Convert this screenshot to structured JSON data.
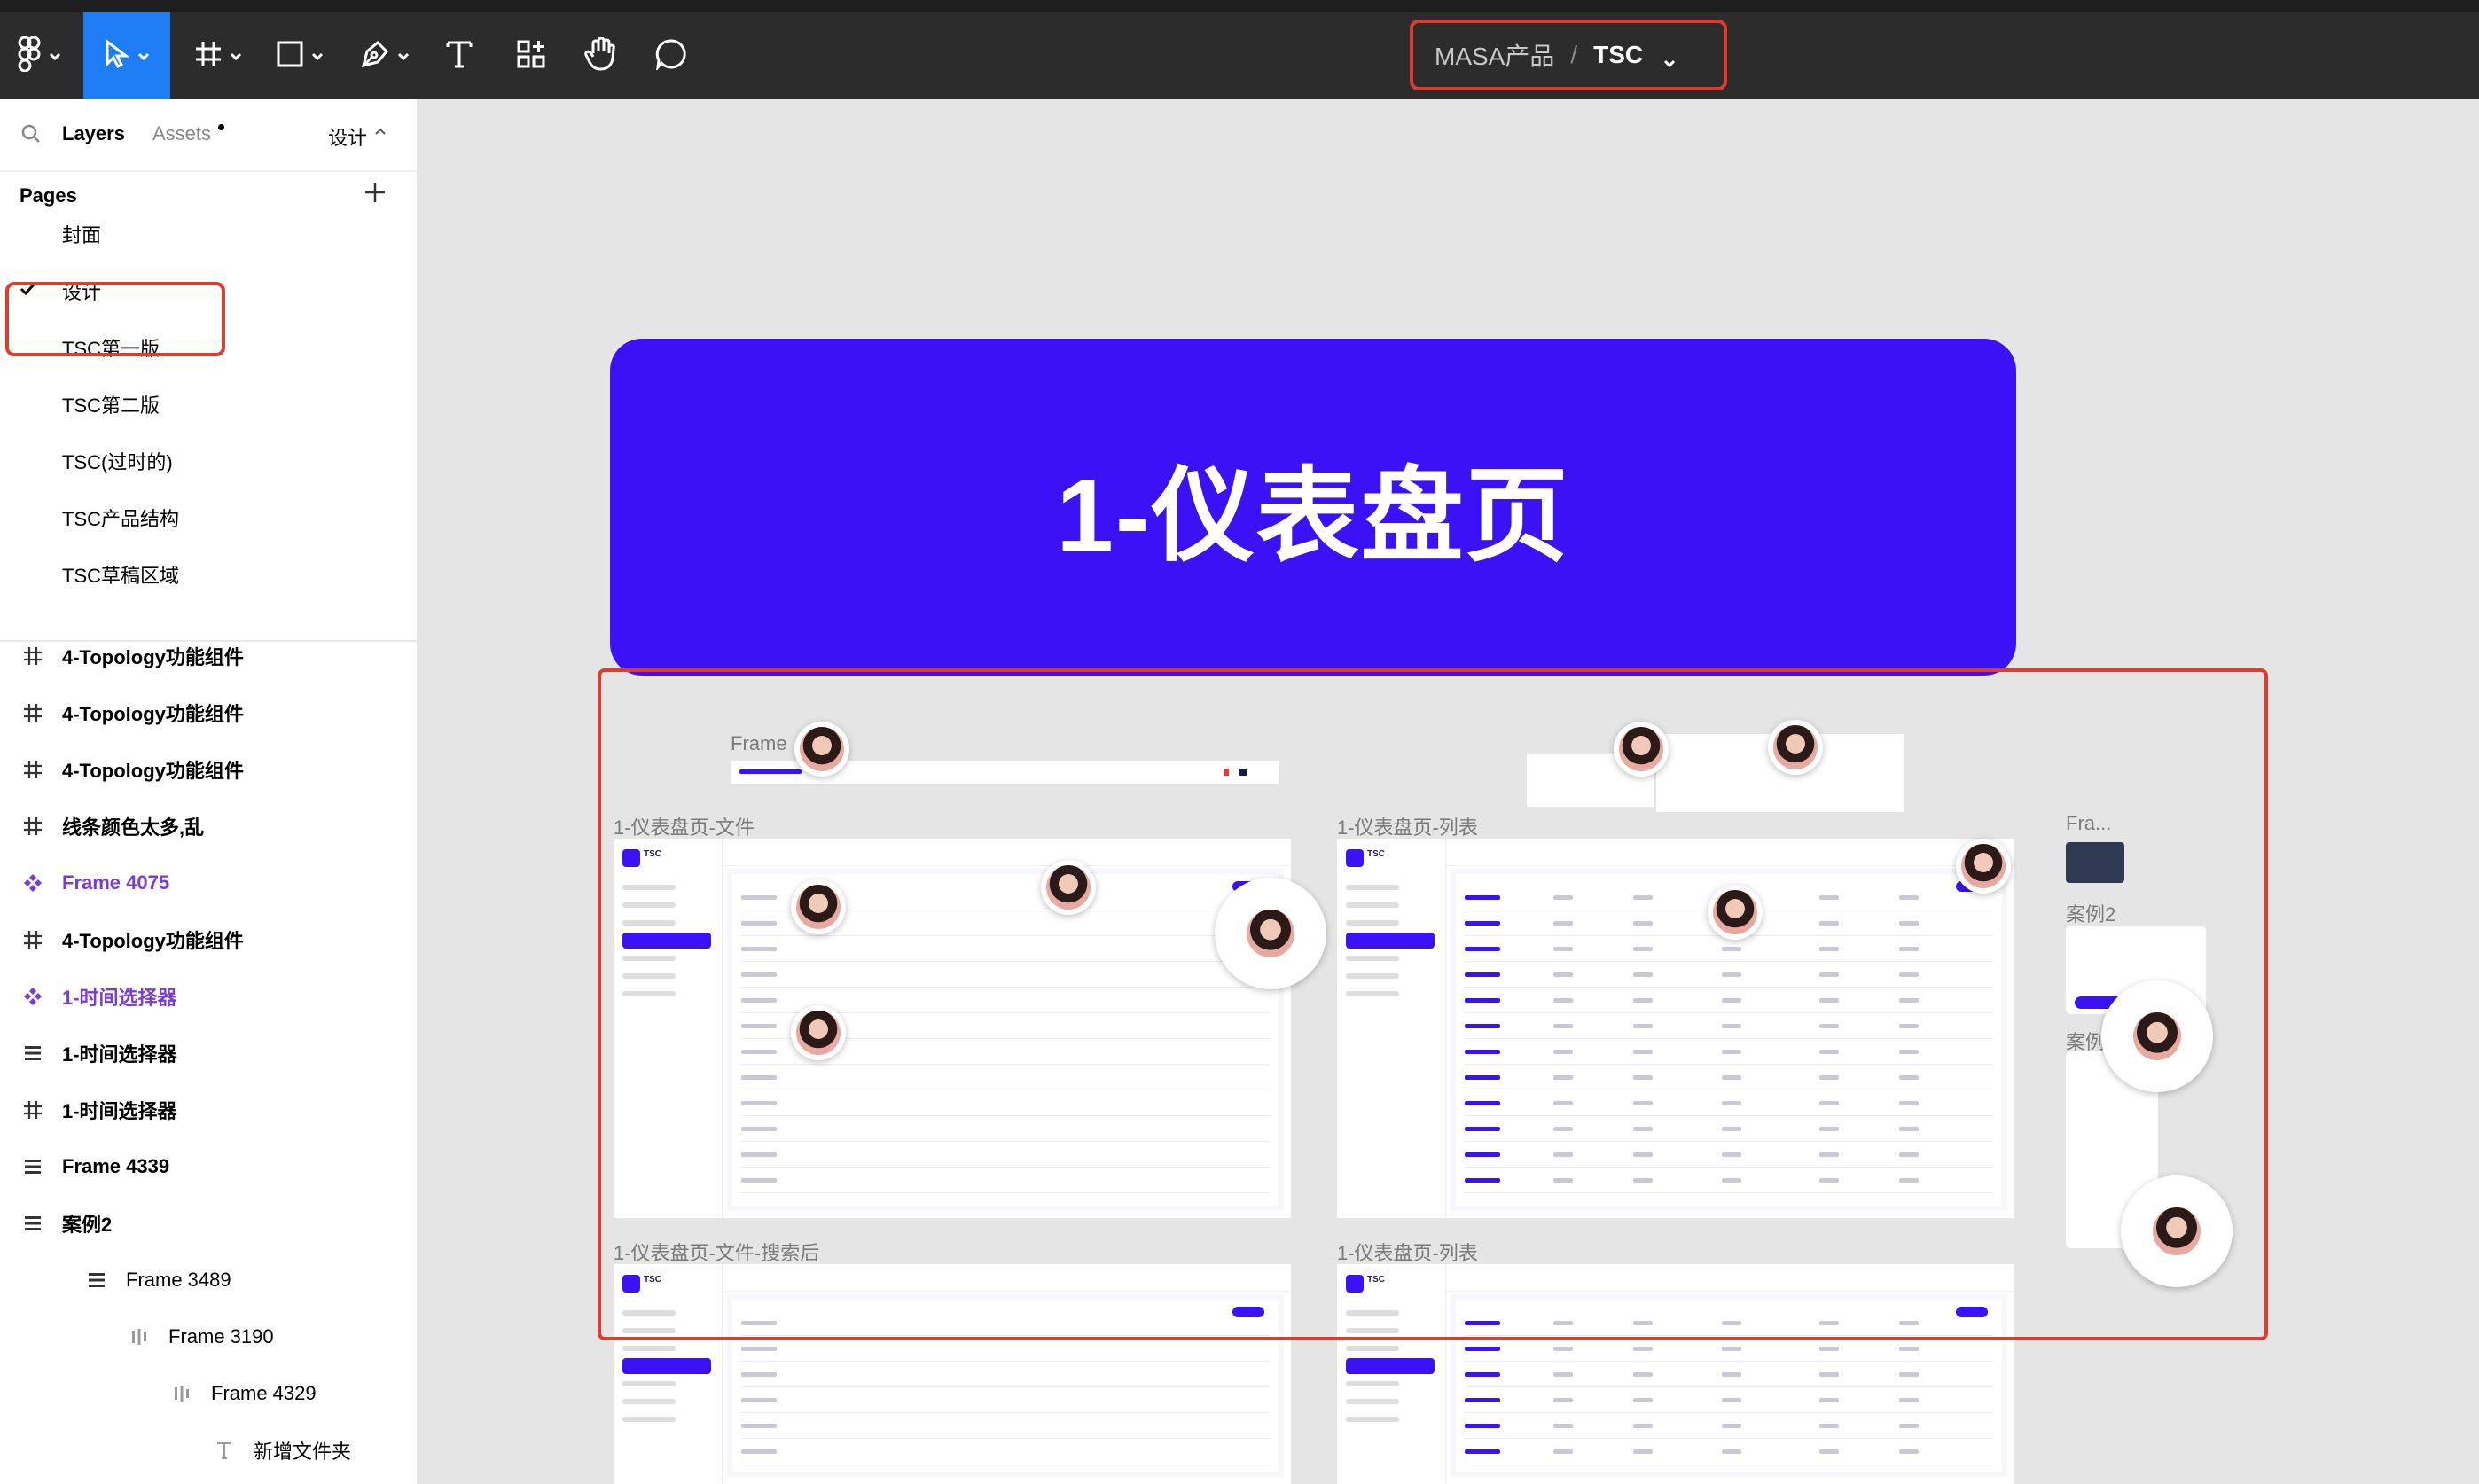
{
  "toolbar": {
    "project": "MASA产品",
    "separator": "/",
    "file": "TSC"
  },
  "panel": {
    "tabs": {
      "layers": "Layers",
      "assets": "Assets",
      "page_switch": "设计"
    },
    "pages_header": "Pages",
    "pages": [
      {
        "label": "封面",
        "selected": false
      },
      {
        "label": "设计",
        "selected": true
      },
      {
        "label": "TSC第一版",
        "selected": false
      },
      {
        "label": "TSC第二版",
        "selected": false
      },
      {
        "label": "TSC(过时的)",
        "selected": false
      },
      {
        "label": "TSC产品结构",
        "selected": false
      },
      {
        "label": "TSC草稿区域",
        "selected": false
      }
    ],
    "layers": [
      {
        "label": "4-Topology功能组件",
        "icon": "frame-icon"
      },
      {
        "label": "4-Topology功能组件",
        "icon": "frame-icon"
      },
      {
        "label": "4-Topology功能组件",
        "icon": "frame-icon"
      },
      {
        "label": "线条颜色太多,乱",
        "icon": "frame-icon"
      },
      {
        "label": "Frame 4075",
        "icon": "component-icon"
      },
      {
        "label": "4-Topology功能组件",
        "icon": "frame-icon"
      },
      {
        "label": "1-时间选择器",
        "icon": "component-icon"
      },
      {
        "label": "1-时间选择器",
        "icon": "auto-layout-vertical-icon"
      },
      {
        "label": "1-时间选择器",
        "icon": "frame-icon"
      },
      {
        "label": "Frame 4339",
        "icon": "auto-layout-vertical-icon"
      },
      {
        "label": "案例2",
        "icon": "auto-layout-vertical-icon"
      },
      {
        "label": "Frame 3489",
        "icon": "auto-layout-vertical-icon"
      },
      {
        "label": "Frame 3190",
        "icon": "auto-layout-horizontal-icon"
      },
      {
        "label": "Frame 4329",
        "icon": "auto-layout-horizontal-icon"
      },
      {
        "label": "新增文件夹",
        "icon": "text-icon"
      }
    ]
  },
  "canvas": {
    "banner_title": "1-仪表盘页",
    "labels": {
      "frame": "Frame",
      "dash_files": "1-仪表盘页-文件",
      "dash_list": "1-仪表盘页-列表",
      "fra": "Fra...",
      "case2": "案例2",
      "case": "案例",
      "dash_files_search": "1-仪表盘页-文件-搜索后",
      "dash_list2": "1-仪表盘页-列表"
    },
    "mock_logo": "TSC"
  },
  "colors": {
    "toolbar_bg": "#2c2c2c",
    "accent_blue": "#1e7cf5",
    "banner": "#3b12f5",
    "highlight_red": "#e03b2f",
    "component_purple": "#7b3bd8",
    "canvas_bg": "#e5e5e5"
  }
}
